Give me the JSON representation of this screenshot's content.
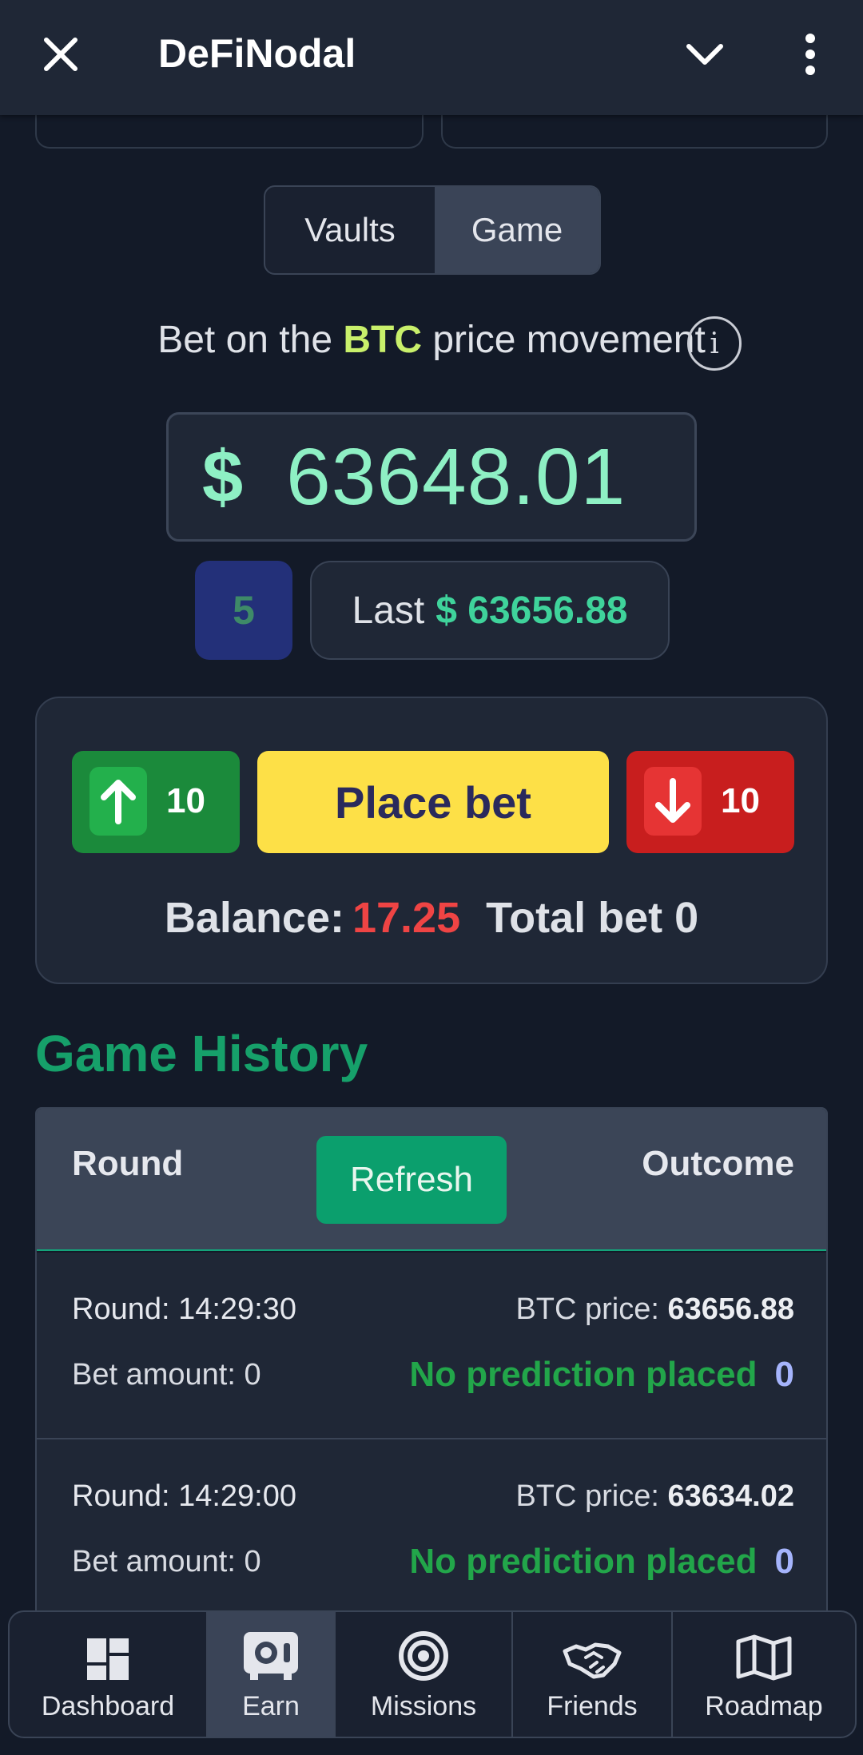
{
  "appbar": {
    "title": "DeFiNodal"
  },
  "tabs": [
    {
      "label": "Vaults"
    },
    {
      "label": "Game"
    }
  ],
  "active_tab": "Game",
  "bet_prompt": {
    "prefix": "Bet on the ",
    "asset": "BTC",
    "suffix": " price movement"
  },
  "info_icon": "i",
  "price": {
    "symbol": "$",
    "value": "63648.01"
  },
  "countdown": "5",
  "last": {
    "label": "Last",
    "value": "$ 63656.88"
  },
  "bet_panel": {
    "up_amount": "10",
    "place_label": "Place bet",
    "down_amount": "10",
    "balance_label": "Balance:",
    "balance_value": "17.25",
    "total_bet": "Total bet 0"
  },
  "history": {
    "title": "Game History",
    "header": {
      "round": "Round",
      "refresh": "Refresh",
      "outcome": "Outcome"
    },
    "rows": [
      {
        "round": "Round: 14:29:30",
        "price_label": "BTC price:",
        "price": "63656.88",
        "bet": "Bet amount: 0",
        "prediction": "No prediction placed",
        "result": "0"
      },
      {
        "round": "Round: 14:29:00",
        "price_label": "BTC price:",
        "price": "63634.02",
        "bet": "Bet amount: 0",
        "prediction": "No prediction placed",
        "result": "0"
      }
    ]
  },
  "nav": [
    {
      "label": "Dashboard",
      "icon": "dashboard-icon"
    },
    {
      "label": "Earn",
      "icon": "safe-icon"
    },
    {
      "label": "Missions",
      "icon": "target-icon"
    },
    {
      "label": "Friends",
      "icon": "handshake-icon"
    },
    {
      "label": "Roadmap",
      "icon": "map-icon"
    }
  ],
  "colors": {
    "accent_green": "#16a06a",
    "price": "#8ef0c4",
    "btc": "#c9f06b",
    "place_bet": "#fde047",
    "up": "#1b8a3b",
    "down": "#c81e1e",
    "balance": "#ef4444"
  }
}
